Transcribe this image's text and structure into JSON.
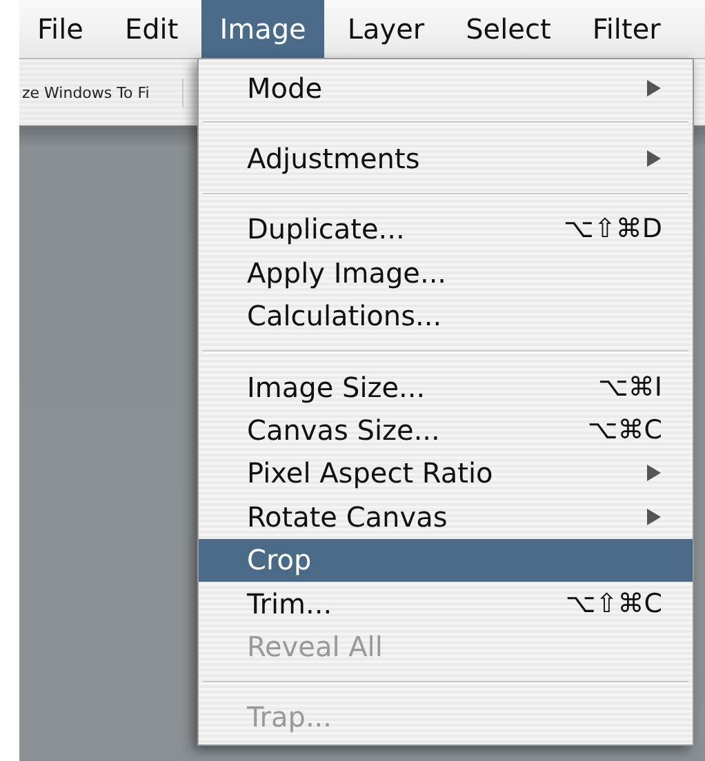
{
  "menu_bar": [
    {
      "label": "File",
      "selected": false
    },
    {
      "label": "Edit",
      "selected": false
    },
    {
      "label": "Image",
      "selected": true
    },
    {
      "label": "Layer",
      "selected": false
    },
    {
      "label": "Select",
      "selected": false
    },
    {
      "label": "Filter",
      "selected": false
    }
  ],
  "options_bar": {
    "button": "ze Windows To Fi"
  },
  "image_menu": {
    "items": [
      {
        "kind": "command",
        "label": "Mode",
        "submenu": true,
        "disabled": false,
        "selected": false
      },
      {
        "kind": "separator"
      },
      {
        "kind": "command",
        "label": "Adjustments",
        "submenu": true,
        "disabled": false,
        "selected": false
      },
      {
        "kind": "separator"
      },
      {
        "kind": "command",
        "label": "Duplicate...",
        "shortcut": "⌥⇧⌘D",
        "submenu": false,
        "disabled": false,
        "selected": false
      },
      {
        "kind": "command",
        "label": "Apply Image...",
        "submenu": false,
        "disabled": false,
        "selected": false
      },
      {
        "kind": "command",
        "label": "Calculations...",
        "submenu": false,
        "disabled": false,
        "selected": false
      },
      {
        "kind": "separator"
      },
      {
        "kind": "command",
        "label": "Image Size...",
        "shortcut": "⌥⌘I",
        "submenu": false,
        "disabled": false,
        "selected": false
      },
      {
        "kind": "command",
        "label": "Canvas Size...",
        "shortcut": "⌥⌘C",
        "submenu": false,
        "disabled": false,
        "selected": false
      },
      {
        "kind": "command",
        "label": "Pixel Aspect Ratio",
        "submenu": true,
        "disabled": false,
        "selected": false
      },
      {
        "kind": "command",
        "label": "Rotate Canvas",
        "submenu": true,
        "disabled": false,
        "selected": false
      },
      {
        "kind": "command",
        "label": "Crop",
        "submenu": false,
        "disabled": false,
        "selected": true
      },
      {
        "kind": "command",
        "label": "Trim...",
        "shortcut": "⌥⇧⌘C",
        "submenu": false,
        "disabled": false,
        "selected": false
      },
      {
        "kind": "command",
        "label": "Reveal All",
        "submenu": false,
        "disabled": true,
        "selected": false
      },
      {
        "kind": "separator"
      },
      {
        "kind": "command",
        "label": "Trap...",
        "submenu": false,
        "disabled": true,
        "selected": false
      }
    ]
  }
}
